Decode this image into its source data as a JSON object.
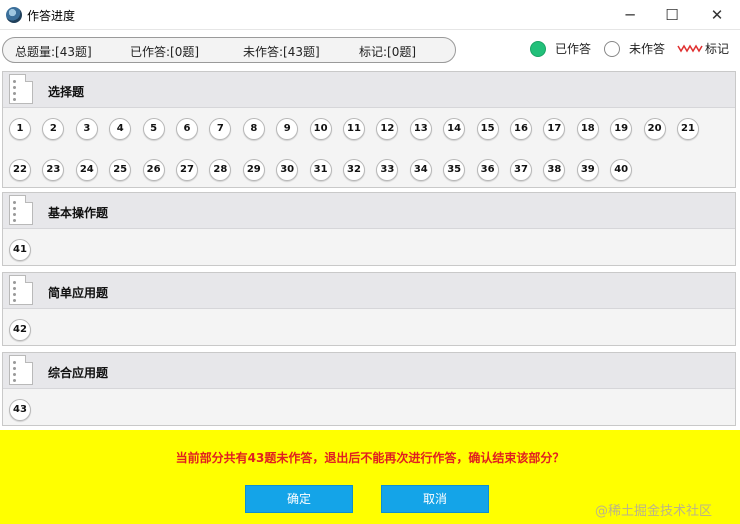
{
  "window": {
    "title": "作答进度",
    "minimize_glyph": "─",
    "maximize_glyph": "☐",
    "close_glyph": "✕"
  },
  "summary": {
    "total": "总题量:[43题]",
    "answered": "已作答:[0题]",
    "unanswered": "未作答:[43题]",
    "marked": "标记:[0题]"
  },
  "legend": {
    "answered": "已作答",
    "unanswered": "未作答",
    "marked": "标记",
    "answered_color": "#22c07a",
    "marked_color": "#e03030"
  },
  "sections": [
    {
      "title": "选择题",
      "questions": [
        "1",
        "2",
        "3",
        "4",
        "5",
        "6",
        "7",
        "8",
        "9",
        "10",
        "11",
        "12",
        "13",
        "14",
        "15",
        "16",
        "17",
        "18",
        "19",
        "20",
        "21",
        "22",
        "23",
        "24",
        "25",
        "26",
        "27",
        "28",
        "29",
        "30",
        "31",
        "32",
        "33",
        "34",
        "35",
        "36",
        "37",
        "38",
        "39",
        "40"
      ]
    },
    {
      "title": "基本操作题",
      "questions": [
        "41"
      ]
    },
    {
      "title": "简单应用题",
      "questions": [
        "42"
      ]
    },
    {
      "title": "综合应用题",
      "questions": [
        "43"
      ]
    }
  ],
  "dialog": {
    "warning": "当前部分共有43题未作答，退出后不能再次进行作答，确认结束该部分？",
    "ok_label": "确定",
    "cancel_label": "取消",
    "panel_color": "#ffff00",
    "button_color": "#14a4e8"
  },
  "watermark": "@稀土掘金技术社区"
}
